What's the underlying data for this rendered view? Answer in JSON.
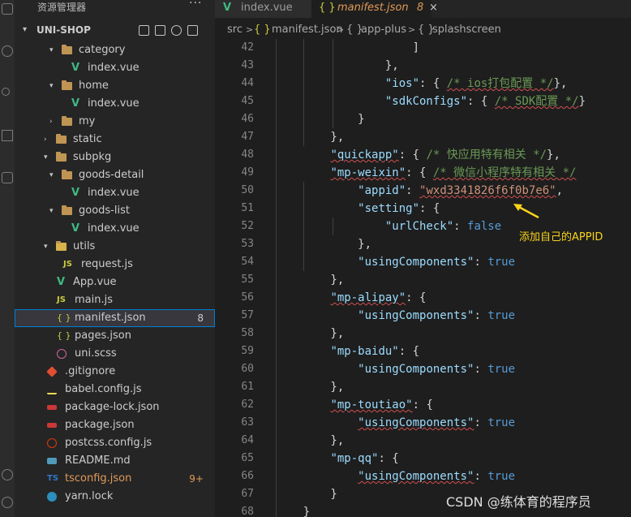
{
  "sidebar": {
    "title": "资源管理器",
    "more": "···",
    "root": "UNI-SHOP",
    "items": [
      {
        "label": "category",
        "kind": "folder",
        "open": true,
        "badge": ""
      },
      {
        "label": "index.vue",
        "kind": "vue",
        "badge": ""
      },
      {
        "label": "home",
        "kind": "folder",
        "open": true,
        "badge": ""
      },
      {
        "label": "index.vue",
        "kind": "vue",
        "badge": ""
      },
      {
        "label": "my",
        "kind": "folder-closed",
        "badge": ""
      },
      {
        "label": "static",
        "kind": "folder-closed",
        "badge": ""
      },
      {
        "label": "subpkg",
        "kind": "folder",
        "open": true,
        "badge": ""
      },
      {
        "label": "goods-detail",
        "kind": "folder",
        "open": true,
        "badge": ""
      },
      {
        "label": "index.vue",
        "kind": "vue",
        "badge": ""
      },
      {
        "label": "goods-list",
        "kind": "folder",
        "open": true,
        "badge": ""
      },
      {
        "label": "index.vue",
        "kind": "vue",
        "badge": ""
      },
      {
        "label": "utils",
        "kind": "folder",
        "open": true,
        "badge": ""
      },
      {
        "label": "request.js",
        "kind": "js",
        "badge": ""
      },
      {
        "label": "App.vue",
        "kind": "vue",
        "badge": ""
      },
      {
        "label": "main.js",
        "kind": "js",
        "badge": ""
      },
      {
        "label": "manifest.json",
        "kind": "json",
        "badge": "8"
      },
      {
        "label": "pages.json",
        "kind": "json",
        "badge": ""
      },
      {
        "label": "uni.scss",
        "kind": "scss",
        "badge": ""
      },
      {
        "label": ".gitignore",
        "kind": "git",
        "badge": ""
      },
      {
        "label": "babel.config.js",
        "kind": "babel",
        "badge": ""
      },
      {
        "label": "package-lock.json",
        "kind": "npm",
        "badge": ""
      },
      {
        "label": "package.json",
        "kind": "npm",
        "badge": ""
      },
      {
        "label": "postcss.config.js",
        "kind": "postcss",
        "badge": ""
      },
      {
        "label": "README.md",
        "kind": "md",
        "badge": ""
      },
      {
        "label": "tsconfig.json",
        "kind": "ts",
        "badge": "9+"
      },
      {
        "label": "yarn.lock",
        "kind": "yarn",
        "badge": ""
      }
    ]
  },
  "tabs": [
    {
      "label": "index.vue",
      "icon": "V"
    },
    {
      "label": "manifest.json",
      "icon": "{ }",
      "badge": "8",
      "close": "×"
    }
  ],
  "breadcrumb": {
    "parts": [
      "src",
      ">",
      "{ }",
      "manifest.json",
      ">",
      "{ }",
      "app-plus",
      ">",
      "{ }",
      "splashscreen"
    ]
  },
  "editor": {
    "line_numbers": [
      "42",
      "43",
      "44",
      "45",
      "46",
      "47",
      "48",
      "49",
      "50",
      "51",
      "52",
      "53",
      "54",
      "55",
      "56",
      "57",
      "58",
      "59",
      "60",
      "61",
      "62",
      "63",
      "64",
      "65",
      "66",
      "67",
      "68"
    ]
  },
  "annotation": "添加自己的APPID",
  "watermark": "CSDN @练体育的程序员",
  "colors": {
    "selected_outline": "#007fd4",
    "modified": "#e09a56",
    "annotation": "#f8d31a"
  }
}
